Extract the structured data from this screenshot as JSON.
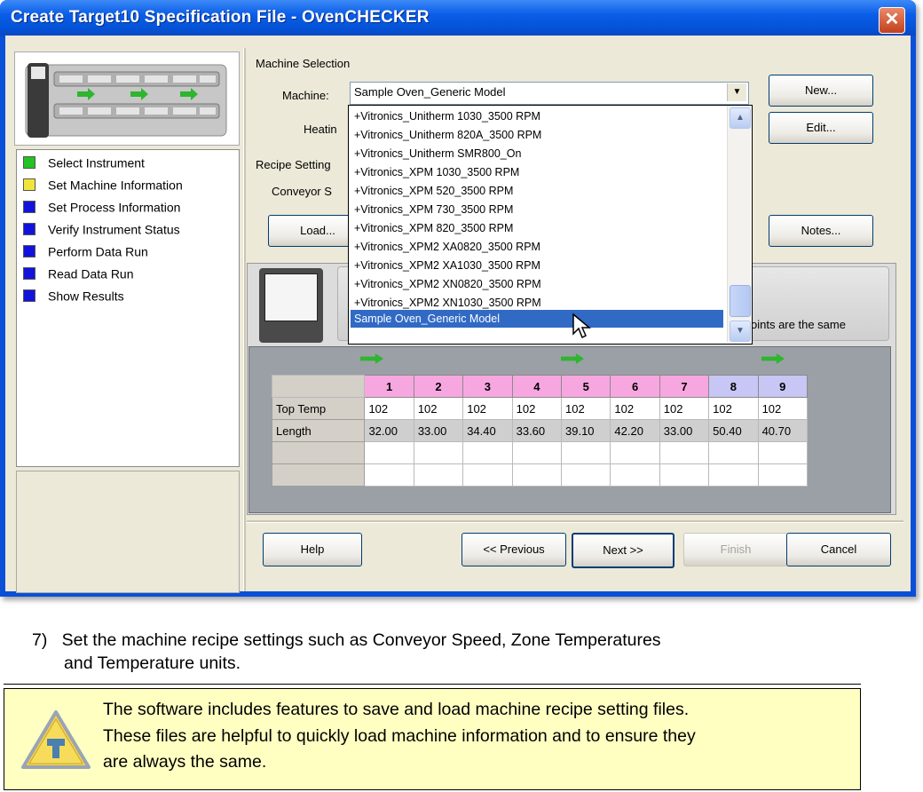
{
  "window": {
    "title": "Create Target10 Specification File - OvenCHECKER",
    "close_glyph": "✕"
  },
  "steps": [
    {
      "label": "Select Instrument",
      "color": "#22c322"
    },
    {
      "label": "Set Machine Information",
      "color": "#f0e63a"
    },
    {
      "label": "Set Process Information",
      "color": "#1212dd"
    },
    {
      "label": "Verify Instrument Status",
      "color": "#1212dd"
    },
    {
      "label": "Perform Data Run",
      "color": "#1212dd"
    },
    {
      "label": "Read Data Run",
      "color": "#1212dd"
    },
    {
      "label": "Show Results",
      "color": "#1212dd"
    }
  ],
  "machine_selection": {
    "group_label": "Machine Selection",
    "machine_label": "Machine:",
    "machine_value": "Sample Oven_Generic Model",
    "heating_label": "Heatin",
    "new_button": "New...",
    "edit_button": "Edit...",
    "dropdown_arrow": "▼"
  },
  "recipe_settings": {
    "group_label": "Recipe Setting",
    "conveyor_label": "Conveyor S",
    "load_button": "Load...",
    "notes_button": "Notes..."
  },
  "dropdown_items": [
    "+Vitronics_Unitherm 1030_3500 RPM",
    "+Vitronics_Unitherm 820A_3500 RPM",
    "+Vitronics_Unitherm SMR800_On",
    "+Vitronics_XPM 1030_3500 RPM",
    "+Vitronics_XPM 520_3500 RPM",
    "+Vitronics_XPM 730_3500 RPM",
    "+Vitronics_XPM 820_3500 RPM",
    "+Vitronics_XPM2 XA0820_3500 RPM",
    "+Vitronics_XPM2 XA1030_3500 RPM",
    "+Vitronics_XPM2 XN0820_3500 RPM",
    "+Vitronics_XPM2 XN1030_3500 RPM",
    "Sample Oven_Generic Model"
  ],
  "dropdown_selected_index": 11,
  "scroll_up_glyph": "▲",
  "scroll_down_glyph": "▼",
  "oven_note": "oints are the same",
  "zone_table": {
    "zones": [
      "1",
      "2",
      "3",
      "4",
      "5",
      "6",
      "7",
      "8",
      "9"
    ],
    "zone_colors": [
      "pink",
      "pink",
      "pink",
      "pink",
      "pink",
      "pink",
      "pink",
      "lav",
      "lav"
    ],
    "rows": [
      {
        "label": "Top Temp",
        "values": [
          "102",
          "102",
          "102",
          "102",
          "102",
          "102",
          "102",
          "102",
          "102"
        ]
      },
      {
        "label": "Length",
        "values": [
          "32.00",
          "33.00",
          "34.40",
          "33.60",
          "39.10",
          "42.20",
          "33.00",
          "50.40",
          "40.70"
        ]
      },
      {
        "label": "",
        "values": [
          "",
          "",
          "",
          "",
          "",
          "",
          "",
          "",
          ""
        ]
      },
      {
        "label": "",
        "values": [
          "",
          "",
          "",
          "",
          "",
          "",
          "",
          "",
          ""
        ]
      }
    ]
  },
  "footer_buttons": {
    "help": "Help",
    "previous": "<< Previous",
    "next": "Next >>",
    "finish": "Finish",
    "cancel": "Cancel"
  },
  "doc": {
    "step_number": "7)",
    "step_line1": "Set the machine recipe settings such as Conveyor Speed, Zone Temperatures",
    "step_line2": "and Temperature units.",
    "note_line1": "The software includes features to save and load machine recipe setting files.",
    "note_line2": "These files are helpful to quickly load machine information and to ensure they",
    "note_line3": "are always the same."
  }
}
